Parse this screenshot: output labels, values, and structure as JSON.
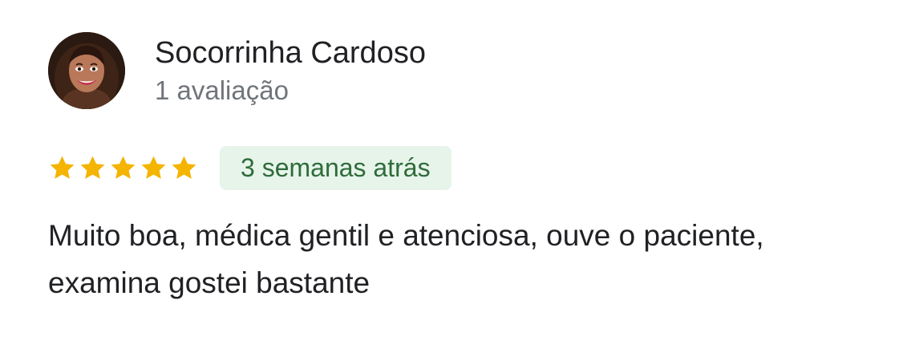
{
  "review": {
    "author": {
      "name": "Socorrinha Cardoso",
      "meta": "1 avaliação",
      "avatar": "profile-photo"
    },
    "rating": {
      "stars": 5,
      "max": 5,
      "star_color": "#f4b400",
      "icon": "star-icon"
    },
    "time_badge": {
      "label": "3 semanas atrás",
      "background": "#e6f4ea",
      "text_color": "#2f6b3a"
    },
    "text": "Muito boa, médica gentil e atenciosa, ouve o paciente, examina gostei bastante"
  }
}
